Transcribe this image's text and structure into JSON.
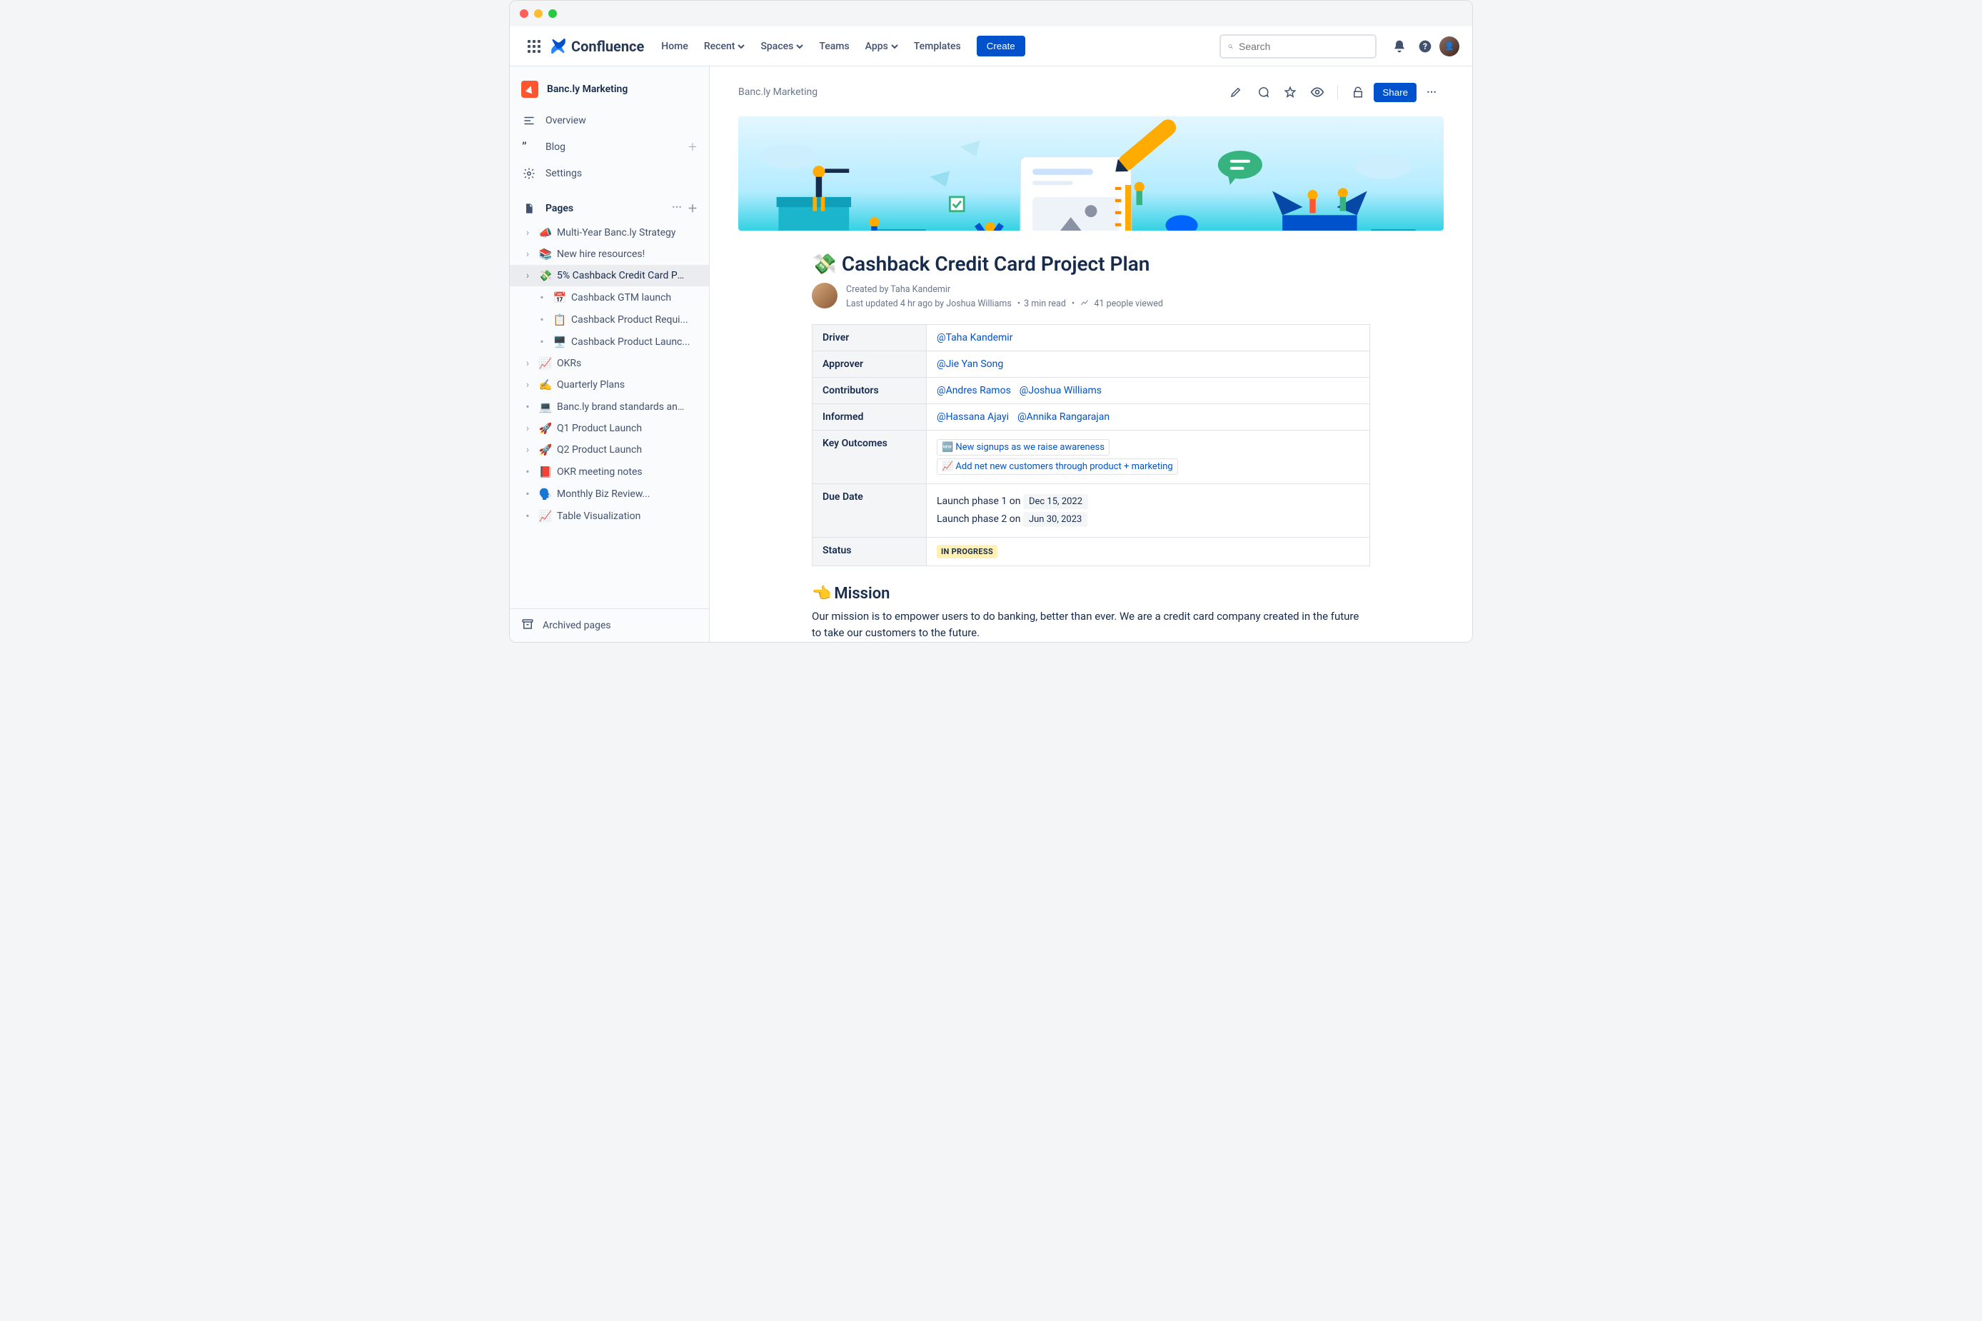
{
  "nav": {
    "product": "Confluence",
    "items": [
      "Home",
      "Recent",
      "Spaces",
      "Teams",
      "Apps",
      "Templates"
    ],
    "dropdown_idx": [
      1,
      2,
      4
    ],
    "create": "Create",
    "search_placeholder": "Search"
  },
  "sidebar": {
    "space": "Banc.ly Marketing",
    "core": [
      {
        "icon": "overview",
        "label": "Overview"
      },
      {
        "icon": "blog",
        "label": "Blog",
        "add": true
      },
      {
        "icon": "settings",
        "label": "Settings"
      }
    ],
    "pages_label": "Pages",
    "tree": [
      {
        "chev": true,
        "emoji": "📣",
        "label": "Multi-Year Banc.ly Strategy"
      },
      {
        "chev": true,
        "emoji": "📚",
        "label": "New hire resources!"
      },
      {
        "chev": true,
        "emoji": "💸",
        "label": "5% Cashback Credit Card Pr...",
        "active": true
      },
      {
        "child": true,
        "emoji": "📅",
        "label": "Cashback GTM launch"
      },
      {
        "child": true,
        "emoji": "📋",
        "label": "Cashback Product Requi..."
      },
      {
        "child": true,
        "emoji": "🖥️",
        "label": "Cashback Product Launc..."
      },
      {
        "chev": true,
        "emoji": "📈",
        "label": "OKRs"
      },
      {
        "chev": true,
        "emoji": "✍️",
        "label": "Quarterly Plans"
      },
      {
        "bullet": true,
        "emoji": "💻",
        "label": "Banc.ly brand standards and..."
      },
      {
        "chev": true,
        "emoji": "🚀",
        "label": "Q1 Product Launch"
      },
      {
        "chev": true,
        "emoji": "🚀",
        "label": "Q2 Product Launch"
      },
      {
        "bullet": true,
        "emoji": "📕",
        "label": "OKR meeting notes"
      },
      {
        "bullet": true,
        "emoji": "🗣️",
        "label": "Monthly Biz Review..."
      },
      {
        "bullet": true,
        "emoji": "📈",
        "label": "Table Visualization"
      }
    ],
    "archived": "Archived pages"
  },
  "page": {
    "breadcrumb": "Banc.ly Marketing",
    "share": "Share",
    "title_emoji": "💸",
    "title": "Cashback Credit Card Project Plan",
    "created_by_prefix": "Created by ",
    "created_by": "Taha Kandemir",
    "updated_prefix": "Last updated ",
    "updated_ago": "4 hr ago",
    "updated_by_prefix": " by ",
    "updated_by": "Joshua Williams",
    "read_time": "3 min read",
    "views": "41 people viewed",
    "mission_emoji": "👈",
    "mission_title": "Mission",
    "mission_body": "Our mission is to empower users to do banking, better than ever. We are a credit card company created in the future to take our customers to the future."
  },
  "daci": {
    "rows": [
      {
        "k": "Driver",
        "mentions": [
          "@Taha Kandemir"
        ]
      },
      {
        "k": "Approver",
        "mentions": [
          "@Jie Yan Song"
        ]
      },
      {
        "k": "Contributors",
        "mentions": [
          "@Andres Ramos",
          "@Joshua Williams"
        ]
      },
      {
        "k": "Informed",
        "mentions": [
          "@Hassana Ajayi",
          "@Annika Rangarajan"
        ]
      }
    ],
    "outcomes_k": "Key Outcomes",
    "outcomes": [
      {
        "emoji": "🆕",
        "text": "New signups as we raise awareness"
      },
      {
        "emoji": "📈",
        "text": "Add net new customers through product + marketing"
      }
    ],
    "due_k": "Due Date",
    "due": [
      {
        "prefix": "Launch phase 1 on ",
        "date": "Dec 15, 2022"
      },
      {
        "prefix": "Launch phase 2 on ",
        "date": "Jun 30, 2023"
      }
    ],
    "status_k": "Status",
    "status": "IN PROGRESS"
  }
}
